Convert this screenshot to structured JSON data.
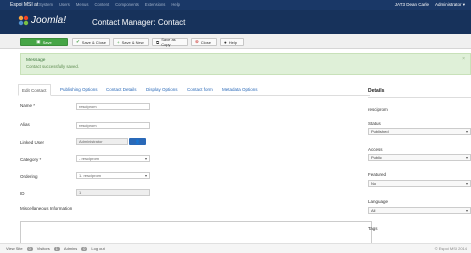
{
  "navbar": {
    "brand": "Espoi MSI at",
    "menu": [
      "System",
      "Users",
      "Menus",
      "Content",
      "Components",
      "Extensions",
      "Help"
    ],
    "right_site": "JAT3 Dean Carle",
    "right_user": "Administrator ▾"
  },
  "header": {
    "logo_text": "Joomla!",
    "title": "Contact Manager: Contact"
  },
  "toolbar": {
    "save_label": "Save",
    "save_close_label": "Save & Close",
    "save_new_label": "Save & New",
    "save_copy_label": "Save as Copy",
    "close_label": "Close",
    "help_label": "Help"
  },
  "message": {
    "heading": "Message",
    "text": "Contact successfully saved.",
    "close": "×"
  },
  "tabs": [
    "Edit Contact",
    "Publishing Options",
    "Contact Details",
    "Display Options",
    "Contact form",
    "Metadata Options"
  ],
  "form": {
    "name_label": "Name *",
    "name_value": "resciprom",
    "alias_label": "Alias",
    "alias_value": "resciprom",
    "linked_user_label": "Linked User",
    "linked_user_value": "Administrator",
    "category_label": "Category *",
    "category_value": "- resciprom",
    "ordering_label": "Ordering",
    "ordering_value": "1. resciprom",
    "id_label": "ID",
    "id_value": "1",
    "misc_label": "Miscellaneous Information"
  },
  "details": {
    "heading": "Details",
    "name_value": "resciprom",
    "status_label": "Status",
    "status_value": "Published",
    "access_label": "Access",
    "access_value": "Public",
    "featured_label": "Featured",
    "featured_value": "No",
    "language_label": "Language",
    "language_value": "All",
    "tags_label": "Tags",
    "tags_placeholder": "Type or select some options"
  },
  "statusbar": {
    "view_site": "View Site",
    "visitors_count": "0",
    "visitors_label": "Visitors",
    "admin_count": "1",
    "admin_label": "Admins",
    "messages_count": "0",
    "logout": "Log out",
    "copyright": "© Espoi MSI 2014"
  },
  "colors": {
    "navbar": "#1a3867",
    "header": "#17325b",
    "save_button": "#46a546",
    "message_bg": "#dff0d8",
    "link": "#2a69b8"
  }
}
